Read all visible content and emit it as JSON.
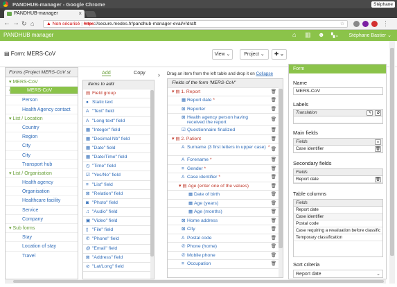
{
  "window": {
    "title": "PANDHUB-manager - Google Chrome",
    "user": "Stéphane"
  },
  "tab": {
    "label": "PANDHUB-manager"
  },
  "url": {
    "warning": "Non sécurisé",
    "protocol": "https",
    "rest": "://secure.medes.fr/pandhub-manager-eval/#/draft"
  },
  "app": {
    "brand": "PANDHUB manager",
    "user": "Stéphane Bastier"
  },
  "formbar": {
    "title": "Form: MERS-CoV",
    "view_label": "View",
    "project_label": "Project"
  },
  "tree": {
    "header": "Forms (Project MERS-CoV st",
    "rows": [
      {
        "kind": "cat",
        "label": "MERS-CoV"
      },
      {
        "kind": "item",
        "label": "MERS-CoV",
        "selected": true
      },
      {
        "kind": "cat",
        "label": "List / People"
      },
      {
        "kind": "item",
        "label": "Person"
      },
      {
        "kind": "item",
        "label": "Health Agency contact"
      },
      {
        "kind": "cat",
        "label": "List / Location"
      },
      {
        "kind": "item",
        "label": "Country"
      },
      {
        "kind": "item",
        "label": "Region"
      },
      {
        "kind": "item",
        "label": "City"
      },
      {
        "kind": "item",
        "label": "City"
      },
      {
        "kind": "item",
        "label": "Transport hub"
      },
      {
        "kind": "cat",
        "label": "List / Organisation"
      },
      {
        "kind": "item",
        "label": "Health agency"
      },
      {
        "kind": "item",
        "label": "Organisation"
      },
      {
        "kind": "item",
        "label": "Healthcare facility"
      },
      {
        "kind": "item",
        "label": "Service"
      },
      {
        "kind": "item",
        "label": "Company"
      },
      {
        "kind": "cat",
        "label": "Sub forms"
      },
      {
        "kind": "item",
        "label": "Stay"
      },
      {
        "kind": "item",
        "label": "Location of stay"
      },
      {
        "kind": "item",
        "label": "Travel"
      }
    ]
  },
  "palette": {
    "tab_add": "Add",
    "tab_copy": "Copy",
    "header": "Items to add",
    "items": [
      {
        "icon": "field-group-icon",
        "glyph": "▤",
        "label": "Field group",
        "red": true
      },
      {
        "icon": "static-text-icon",
        "glyph": "●",
        "label": "Static text"
      },
      {
        "icon": "text-icon",
        "glyph": "A",
        "label": "\"Text\" field"
      },
      {
        "icon": "long-text-icon",
        "glyph": "A",
        "label": "\"Long text\" field"
      },
      {
        "icon": "integer-icon",
        "glyph": "▦",
        "label": "\"Integer\" field"
      },
      {
        "icon": "decimal-icon",
        "glyph": "▦",
        "label": "\"Decimal Nb\" field"
      },
      {
        "icon": "date-icon",
        "glyph": "▦",
        "label": "\"Date\" field"
      },
      {
        "icon": "datetime-icon",
        "glyph": "▦",
        "label": "\"Date/Time\" field"
      },
      {
        "icon": "time-icon",
        "glyph": "◷",
        "label": "\"Time\" field"
      },
      {
        "icon": "yesno-icon",
        "glyph": "☑",
        "label": "\"Yes/No\" field"
      },
      {
        "icon": "list-icon",
        "glyph": "≡",
        "label": "\"List\" field"
      },
      {
        "icon": "relation-icon",
        "glyph": "⊠",
        "label": "\"Relation\" field"
      },
      {
        "icon": "photo-icon",
        "glyph": "◙",
        "label": "\"Photo\" field"
      },
      {
        "icon": "audio-icon",
        "glyph": "♫",
        "label": "\"Audio\" field"
      },
      {
        "icon": "video-icon",
        "glyph": "▣",
        "label": "\"Video\" field"
      },
      {
        "icon": "file-icon",
        "glyph": "▯",
        "label": "\"File\" field"
      },
      {
        "icon": "phone-icon",
        "glyph": "✆",
        "label": "\"Phone\" field"
      },
      {
        "icon": "email-icon",
        "glyph": "@",
        "label": "\"Email\" field"
      },
      {
        "icon": "address-icon",
        "glyph": "⊠",
        "label": "\"Address\" field"
      },
      {
        "icon": "latlong-icon",
        "glyph": "⊘",
        "label": "\"Lat/Long\" field"
      }
    ]
  },
  "fields": {
    "hint": "Drag an item from the left table and drop it on",
    "collapse": "Collapse",
    "header": "Fields of the form 'MERS-CoV'",
    "rows": [
      {
        "kind": "sec",
        "indent": 0,
        "label": "1. Report",
        "glyph": "▤"
      },
      {
        "kind": "f",
        "indent": 1,
        "label": "Report date",
        "req": true,
        "glyph": "▦"
      },
      {
        "kind": "f",
        "indent": 1,
        "label": "Reporter",
        "glyph": "⊠"
      },
      {
        "kind": "f2",
        "indent": 1,
        "label": "Health agency person having received the report",
        "glyph": "⊠"
      },
      {
        "kind": "f",
        "indent": 1,
        "label": "Questionnaire finalized",
        "glyph": "☑"
      },
      {
        "kind": "sec",
        "indent": 0,
        "label": "2. Patient",
        "glyph": "▤"
      },
      {
        "kind": "f2",
        "indent": 1,
        "label": "Surname (3 first letters in upper case)",
        "req": true,
        "glyph": "A"
      },
      {
        "kind": "f",
        "indent": 1,
        "label": "Forename",
        "req": true,
        "glyph": "A"
      },
      {
        "kind": "f",
        "indent": 1,
        "label": "Gender",
        "req": true,
        "glyph": "≡"
      },
      {
        "kind": "f",
        "indent": 1,
        "label": "Case identifier",
        "req": true,
        "glyph": "A"
      },
      {
        "kind": "sec",
        "indent": 1,
        "label": "Age (enter one of the values)",
        "glyph": "▤"
      },
      {
        "kind": "f",
        "indent": 2,
        "label": "Date of birth",
        "glyph": "▦"
      },
      {
        "kind": "f",
        "indent": 2,
        "label": "Age (years)",
        "glyph": "▦"
      },
      {
        "kind": "f",
        "indent": 2,
        "label": "Age (months)",
        "glyph": "▦"
      },
      {
        "kind": "f",
        "indent": 1,
        "label": "Home address",
        "glyph": "⊠"
      },
      {
        "kind": "f",
        "indent": 1,
        "label": "City",
        "glyph": "⊠"
      },
      {
        "kind": "f",
        "indent": 1,
        "label": "Postal code",
        "glyph": "A"
      },
      {
        "kind": "f",
        "indent": 1,
        "label": "Phone (home)",
        "glyph": "✆"
      },
      {
        "kind": "f",
        "indent": 1,
        "label": "Mobile phone",
        "glyph": "✆"
      },
      {
        "kind": "f",
        "indent": 1,
        "label": "Occupation",
        "glyph": "≡"
      }
    ]
  },
  "panel": {
    "title": "Form",
    "name_label": "Name",
    "name_value": "MERS-CoV",
    "labels_label": "Labels",
    "translation_header": "Translation",
    "main_fields_label": "Main fields",
    "main_fields": {
      "header": "Fields",
      "rows": [
        "Case identifier"
      ]
    },
    "secondary_fields_label": "Secondary fields",
    "secondary_fields": {
      "header": "Fields",
      "rows": [
        "Report date"
      ]
    },
    "table_columns_label": "Table columns",
    "table_columns": {
      "header": "Fields",
      "rows": [
        "Report date",
        "Case identifier",
        "Postal code",
        "Case requiring a revaluation before classific",
        "Temporary classification"
      ]
    },
    "sort_label": "Sort criteria",
    "sort_value": "Report date"
  },
  "colors": {
    "brand_green": "#8bc34a",
    "link_blue": "#2e6bb8",
    "section_red": "#c0392b"
  }
}
